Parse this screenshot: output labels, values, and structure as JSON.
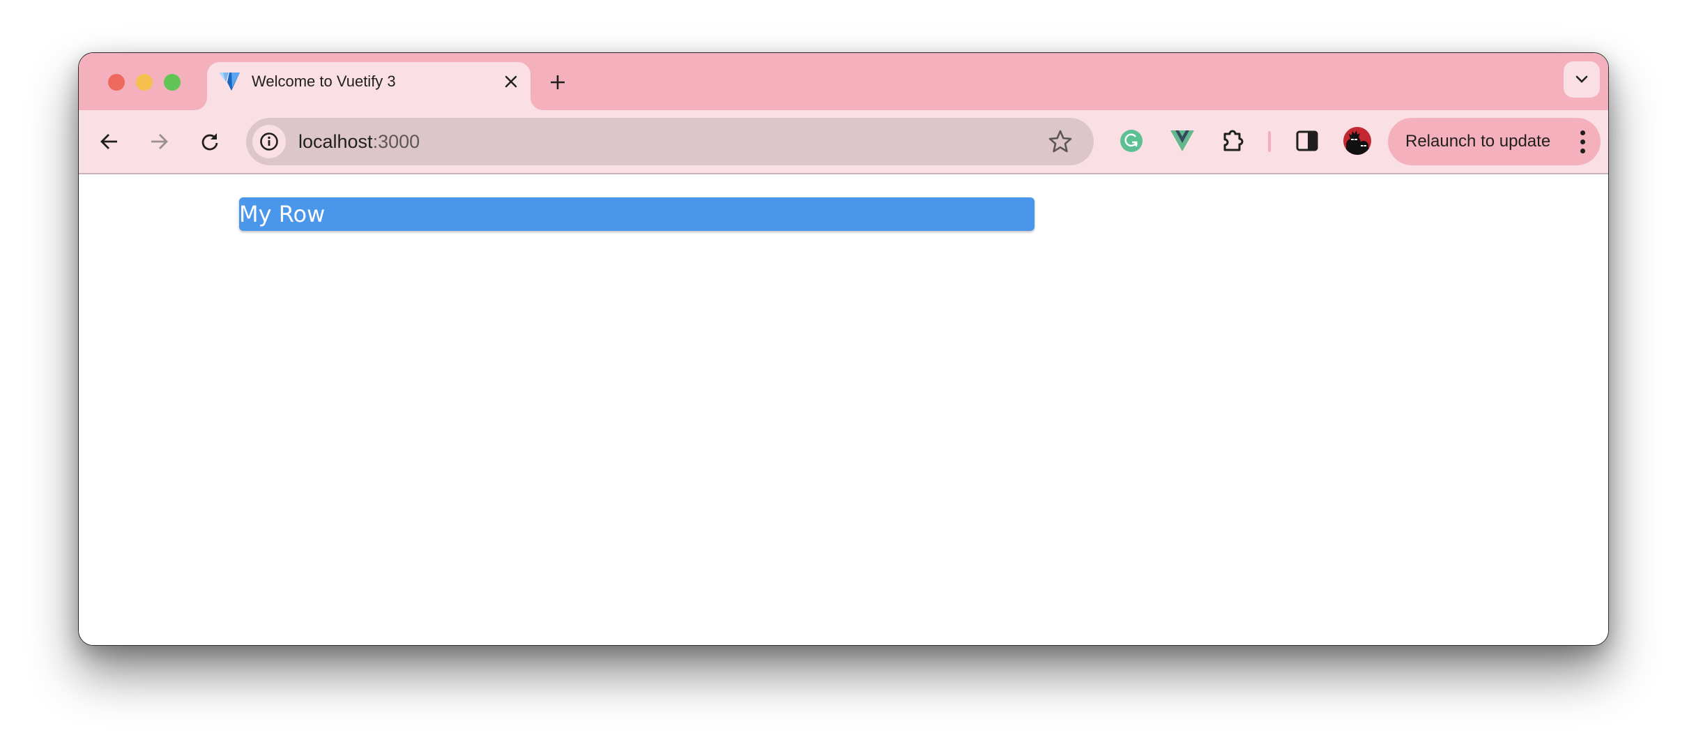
{
  "browser": {
    "tab": {
      "title": "Welcome to Vuetify 3",
      "favicon": "vuetify-logo-icon"
    },
    "new_tab_icon": "plus-icon",
    "tab_search_icon": "chevron-down-icon",
    "navigation": {
      "back_icon": "arrow-left-icon",
      "forward_icon": "arrow-right-icon",
      "reload_icon": "reload-icon"
    },
    "omnibox": {
      "host": "localhost",
      "port": ":3000",
      "site_info_icon": "info-icon",
      "bookmark_icon": "star-icon"
    },
    "extensions": [
      {
        "name": "Grammarly",
        "icon": "grammarly-icon",
        "color": "#15c39a"
      },
      {
        "name": "Vue.js devtools",
        "icon": "vue-icon",
        "color": "#41b883"
      },
      {
        "name": "Extensions",
        "icon": "puzzle-icon"
      }
    ],
    "side_panel_icon": "side-panel-icon",
    "profile_avatar": "avatar",
    "relaunch": {
      "label": "Relaunch to update",
      "menu_icon": "more-vert-icon"
    },
    "colors": {
      "tabbar": "#f4b1bd",
      "toolbar": "#fae0e5",
      "omnibox": "#dcc6c9"
    }
  },
  "page": {
    "row_label": "My Row",
    "row_color": "#4a96ea"
  }
}
